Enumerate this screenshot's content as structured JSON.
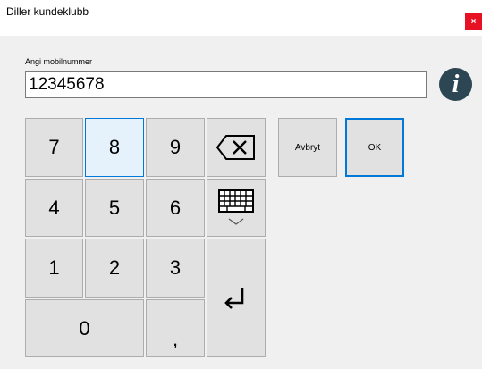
{
  "window": {
    "title": "Diller kundeklubb",
    "close_label": "×"
  },
  "phone": {
    "label": "Angi mobilnummer",
    "value": "12345678"
  },
  "info": {
    "glyph": "i"
  },
  "keypad": {
    "digits": [
      "7",
      "8",
      "9",
      "4",
      "5",
      "6",
      "1",
      "2",
      "3",
      "0"
    ],
    "comma": ",",
    "backspace_icon": "backspace-icon",
    "keyboard_icon": "keyboard-icon",
    "enter_icon": "enter-icon"
  },
  "actions": {
    "cancel_label": "Avbryt",
    "ok_label": "OK"
  },
  "colors": {
    "accent": "#0078d7",
    "close": "#e81123",
    "info": "#2d4654"
  }
}
